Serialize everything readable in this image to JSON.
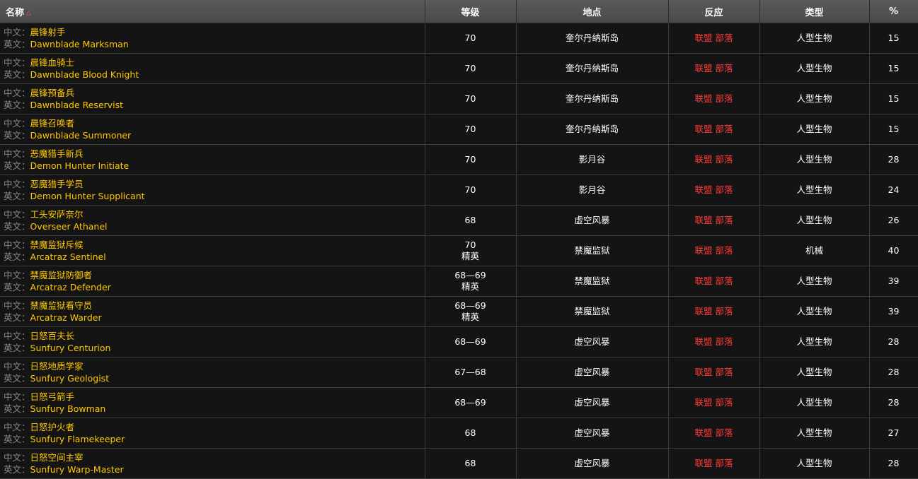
{
  "headers": {
    "name": "名称",
    "level": "等级",
    "location": "地点",
    "reaction": "反应",
    "type": "类型",
    "percent": "%"
  },
  "sort_icon": "triangle-up-icon",
  "labels": {
    "cn": "中文：",
    "en": "英文："
  },
  "colors": {
    "name": "#ffc800",
    "reaction": "#ff3a3a",
    "label": "#8a8a8a",
    "header_bg": "#4f4f4f",
    "row_bg": "#141414"
  },
  "rows": [
    {
      "cn": "晨锋射手",
      "en": "Dawnblade Marksman",
      "level": "70",
      "elite": "",
      "location": "奎尔丹纳斯岛",
      "reaction": "联盟 部落",
      "type": "人型生物",
      "pct": "15"
    },
    {
      "cn": "晨锋血骑士",
      "en": "Dawnblade Blood Knight",
      "level": "70",
      "elite": "",
      "location": "奎尔丹纳斯岛",
      "reaction": "联盟 部落",
      "type": "人型生物",
      "pct": "15"
    },
    {
      "cn": "晨锋预备兵",
      "en": "Dawnblade Reservist",
      "level": "70",
      "elite": "",
      "location": "奎尔丹纳斯岛",
      "reaction": "联盟 部落",
      "type": "人型生物",
      "pct": "15"
    },
    {
      "cn": "晨锋召唤者",
      "en": "Dawnblade Summoner",
      "level": "70",
      "elite": "",
      "location": "奎尔丹纳斯岛",
      "reaction": "联盟 部落",
      "type": "人型生物",
      "pct": "15"
    },
    {
      "cn": "恶魔猎手新兵",
      "en": "Demon Hunter Initiate",
      "level": "70",
      "elite": "",
      "location": "影月谷",
      "reaction": "联盟 部落",
      "type": "人型生物",
      "pct": "28"
    },
    {
      "cn": "恶魔猎手学员",
      "en": "Demon Hunter Supplicant",
      "level": "70",
      "elite": "",
      "location": "影月谷",
      "reaction": "联盟 部落",
      "type": "人型生物",
      "pct": "24"
    },
    {
      "cn": "工头安萨奈尔",
      "en": "Overseer Athanel",
      "level": "68",
      "elite": "",
      "location": "虚空风暴",
      "reaction": "联盟 部落",
      "type": "人型生物",
      "pct": "26"
    },
    {
      "cn": "禁魔监狱斥候",
      "en": "Arcatraz Sentinel",
      "level": "70",
      "elite": "精英",
      "location": "禁魔监狱",
      "reaction": "联盟 部落",
      "type": "机械",
      "pct": "40"
    },
    {
      "cn": "禁魔监狱防御者",
      "en": "Arcatraz Defender",
      "level": "68—69",
      "elite": "精英",
      "location": "禁魔监狱",
      "reaction": "联盟 部落",
      "type": "人型生物",
      "pct": "39"
    },
    {
      "cn": "禁魔监狱看守员",
      "en": "Arcatraz Warder",
      "level": "68—69",
      "elite": "精英",
      "location": "禁魔监狱",
      "reaction": "联盟 部落",
      "type": "人型生物",
      "pct": "39"
    },
    {
      "cn": "日怒百夫长",
      "en": "Sunfury Centurion",
      "level": "68—69",
      "elite": "",
      "location": "虚空风暴",
      "reaction": "联盟 部落",
      "type": "人型生物",
      "pct": "28"
    },
    {
      "cn": "日怒地质学家",
      "en": "Sunfury Geologist",
      "level": "67—68",
      "elite": "",
      "location": "虚空风暴",
      "reaction": "联盟 部落",
      "type": "人型生物",
      "pct": "28"
    },
    {
      "cn": "日怒弓箭手",
      "en": "Sunfury Bowman",
      "level": "68—69",
      "elite": "",
      "location": "虚空风暴",
      "reaction": "联盟 部落",
      "type": "人型生物",
      "pct": "28"
    },
    {
      "cn": "日怒护火者",
      "en": "Sunfury Flamekeeper",
      "level": "68",
      "elite": "",
      "location": "虚空风暴",
      "reaction": "联盟 部落",
      "type": "人型生物",
      "pct": "27"
    },
    {
      "cn": "日怒空间主宰",
      "en": "Sunfury Warp-Master",
      "level": "68",
      "elite": "",
      "location": "虚空风暴",
      "reaction": "联盟 部落",
      "type": "人型生物",
      "pct": "28"
    }
  ]
}
